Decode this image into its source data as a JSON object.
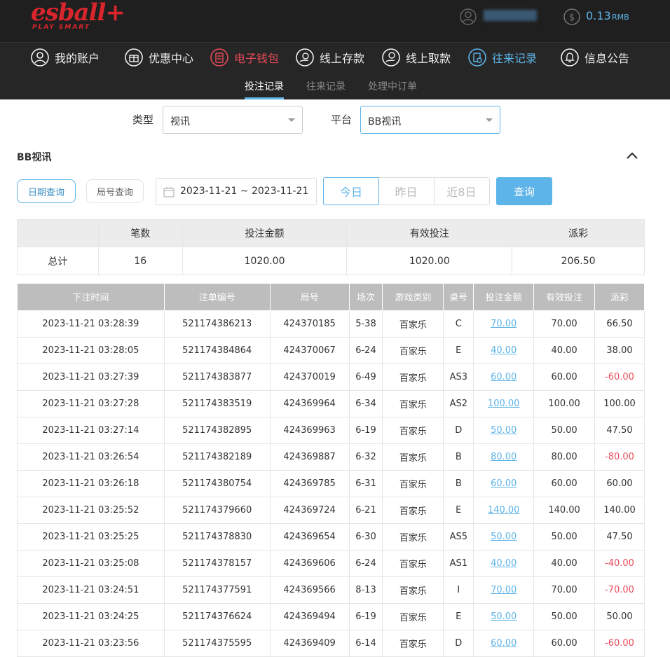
{
  "brand": {
    "logo": "esball+",
    "tagline": "PLAY SMART",
    "color": "#d9262c"
  },
  "header": {
    "balance": "0.13",
    "currency": "RMB"
  },
  "nav": [
    {
      "label": "我的账户",
      "icon": "user-circle-icon"
    },
    {
      "label": "优惠中心",
      "icon": "gift-icon"
    },
    {
      "label": "电子钱包",
      "icon": "wallet-icon"
    },
    {
      "label": "线上存款",
      "icon": "deposit-icon"
    },
    {
      "label": "线上取款",
      "icon": "withdraw-icon"
    },
    {
      "label": "往来记录",
      "icon": "record-icon"
    },
    {
      "label": "信息公告",
      "icon": "bell-icon"
    }
  ],
  "subnav": [
    "投注记录",
    "往来记录",
    "处理中订单"
  ],
  "filter": {
    "type_label": "类型",
    "type_value": "视讯",
    "platform_label": "平台",
    "platform_value": "BB视讯"
  },
  "section": {
    "title": "BB视讯"
  },
  "query": {
    "date_query": "日期查询",
    "round_query": "局号查询",
    "date_range": "2023-11-21 ~ 2023-11-21",
    "today": "今日",
    "yesterday": "昨日",
    "last8": "近8日",
    "submit": "查询"
  },
  "summary": {
    "headers": [
      "",
      "笔数",
      "投注金额",
      "有效投注",
      "派彩"
    ],
    "row": [
      "总计",
      "16",
      "1020.00",
      "1020.00",
      "206.50"
    ]
  },
  "detail": {
    "headers": [
      "下注时间",
      "注单编号",
      "局号",
      "场次",
      "游戏类别",
      "桌号",
      "投注金额",
      "有效投注",
      "派彩"
    ],
    "rows": [
      [
        "2023-11-21 03:28:39",
        "521174386213",
        "424370185",
        "5-38",
        "百家乐",
        "C",
        "70.00",
        "70.00",
        "66.50"
      ],
      [
        "2023-11-21 03:28:05",
        "521174384864",
        "424370067",
        "6-24",
        "百家乐",
        "E",
        "40.00",
        "40.00",
        "38.00"
      ],
      [
        "2023-11-21 03:27:39",
        "521174383877",
        "424370019",
        "6-49",
        "百家乐",
        "AS3",
        "60.00",
        "60.00",
        "-60.00"
      ],
      [
        "2023-11-21 03:27:28",
        "521174383519",
        "424369964",
        "6-34",
        "百家乐",
        "AS2",
        "100.00",
        "100.00",
        "100.00"
      ],
      [
        "2023-11-21 03:27:14",
        "521174382895",
        "424369963",
        "6-19",
        "百家乐",
        "D",
        "50.00",
        "50.00",
        "47.50"
      ],
      [
        "2023-11-21 03:26:54",
        "521174382189",
        "424369887",
        "6-32",
        "百家乐",
        "B",
        "80.00",
        "80.00",
        "-80.00"
      ],
      [
        "2023-11-21 03:26:18",
        "521174380754",
        "424369785",
        "6-31",
        "百家乐",
        "B",
        "60.00",
        "60.00",
        "60.00"
      ],
      [
        "2023-11-21 03:25:52",
        "521174379660",
        "424369724",
        "6-21",
        "百家乐",
        "E",
        "140.00",
        "140.00",
        "140.00"
      ],
      [
        "2023-11-21 03:25:25",
        "521174378830",
        "424369654",
        "6-30",
        "百家乐",
        "AS5",
        "50.00",
        "50.00",
        "47.50"
      ],
      [
        "2023-11-21 03:25:08",
        "521174378157",
        "424369606",
        "6-24",
        "百家乐",
        "AS1",
        "40.00",
        "40.00",
        "-40.00"
      ],
      [
        "2023-11-21 03:24:51",
        "521174377591",
        "424369566",
        "8-13",
        "百家乐",
        "I",
        "70.00",
        "70.00",
        "-70.00"
      ],
      [
        "2023-11-21 03:24:25",
        "521174376624",
        "424369494",
        "6-19",
        "百家乐",
        "E",
        "50.00",
        "50.00",
        "50.00"
      ],
      [
        "2023-11-21 03:23:56",
        "521174375595",
        "424369409",
        "6-14",
        "百家乐",
        "D",
        "60.00",
        "60.00",
        "-60.00"
      ]
    ]
  },
  "colors": {
    "accent": "#5db4e8",
    "negative": "#e74a59",
    "header_bg": "#1f1f1f"
  }
}
